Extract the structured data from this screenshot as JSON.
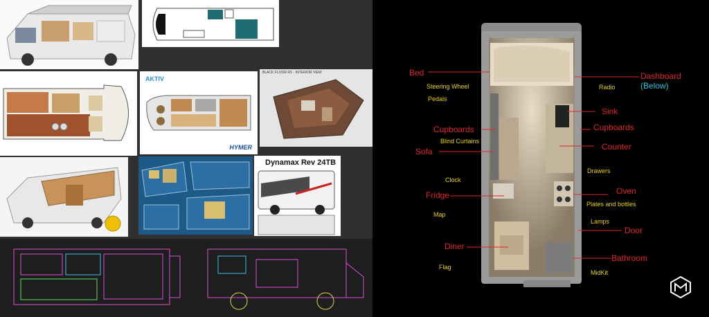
{
  "collage": {
    "tile_logo_aktiv": "AKTIV",
    "tile_logo_hymer": "HYMER",
    "tile_caption_black": "BLACK FLOOR RV - INTERIOR VIEW",
    "tile_title_dynamax": "Dynamax Rev 24TB"
  },
  "annotations": {
    "bed": "Bed",
    "dashboard": "Dashboard",
    "dashboard_note": "(Below)",
    "steering_wheel": "Steering Wheel",
    "radio": "Radio",
    "pedals": "Pedals",
    "sink": "Sink",
    "cupboards_left": "Cupboards",
    "cupboards_right": "Cupboards",
    "blind_curtains": "Blind Curtains",
    "sofa": "Sofa",
    "counter": "Counter",
    "drawers": "Drawers",
    "clock": "Clock",
    "fridge": "Fridge",
    "oven": "Oven",
    "plates": "Plates and bottles",
    "map": "Map",
    "lamps": "Lamps",
    "door": "Door",
    "diner": "Diner",
    "bathroom": "Bathroom",
    "flag": "Flag",
    "midkit": "MidKit"
  },
  "colors": {
    "label_red": "#e0242a",
    "label_yellow": "#e8d200",
    "label_cyan": "#25c3d6"
  }
}
